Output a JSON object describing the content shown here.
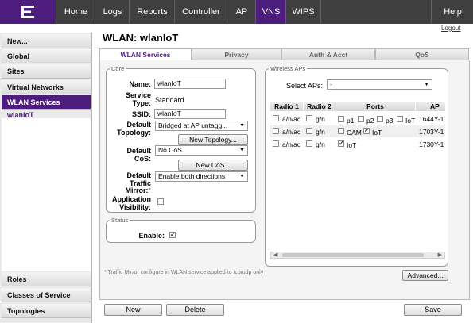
{
  "nav": {
    "items": [
      "Home",
      "Logs",
      "Reports",
      "Controller",
      "AP",
      "VNS",
      "WIPS",
      "Help"
    ],
    "active": "VNS",
    "logout": "Logout"
  },
  "sidebar": {
    "items": [
      "New...",
      "Global",
      "Sites",
      "Virtual Networks",
      "WLAN Services"
    ],
    "sub_item": "wlanIoT",
    "bottom_items": [
      "Roles",
      "Classes of Service",
      "Topologies"
    ]
  },
  "page": {
    "title": "WLAN: wlanIoT"
  },
  "tabs": [
    "WLAN Services",
    "Privacy",
    "Auth & Acct",
    "QoS"
  ],
  "core": {
    "legend": "Core",
    "name_label": "Name:",
    "name_value": "wlanIoT",
    "service_type_label_1": "Service",
    "service_type_label_2": "Type:",
    "service_type_value": "Standard",
    "ssid_label": "SSID:",
    "ssid_value": "wlanIoT",
    "topology_label_1": "Default",
    "topology_label_2": "Topology:",
    "topology_value": "Bridged at AP untagg...",
    "new_topology_button": "New Topology...",
    "cos_label_1": "Default",
    "cos_label_2": "CoS:",
    "cos_value": "No CoS",
    "new_cos_button": "New CoS...",
    "mirror_label_1": "Default",
    "mirror_label_2": "Traffic",
    "mirror_label_3": "Mirror:",
    "mirror_asterisk": "*",
    "mirror_value": "Enable both directions",
    "app_vis_label_1": "Application",
    "app_vis_label_2": "Visibility:",
    "app_vis_checked": false
  },
  "status": {
    "legend": "Status",
    "enable_label": "Enable:",
    "enable_checked": true
  },
  "wireless_aps": {
    "legend": "Wireless APs",
    "select_label": "Select APs:",
    "select_value": "-",
    "columns": [
      "Radio 1",
      "Radio 2",
      "Ports",
      "AP"
    ],
    "rows": [
      {
        "radio1": "a/n/ac",
        "radio2": "g/n",
        "ports": [
          "p1",
          "p2",
          "p3",
          "IoT"
        ],
        "ports_checked": [
          false,
          false,
          false,
          false
        ],
        "ap": "1644Y-1"
      },
      {
        "radio1": "a/n/ac",
        "radio2": "g/n",
        "ports": [
          "CAM",
          "IoT"
        ],
        "ports_checked": [
          false,
          true
        ],
        "ap": "1703Y-1"
      },
      {
        "radio1": "a/n/ac",
        "radio2": "g/n",
        "ports": [
          "IoT"
        ],
        "ports_checked": [
          true
        ],
        "ap": "1730Y-1"
      }
    ],
    "advanced_button": "Advanced..."
  },
  "footnote": "* Traffic Mirror configure in WLAN service applied to tcp/udp only",
  "buttons": {
    "new": "New",
    "delete": "Delete",
    "save": "Save"
  },
  "colors": {
    "brand": "#4c1d7d",
    "nav_bg": "#3f3f3f"
  }
}
